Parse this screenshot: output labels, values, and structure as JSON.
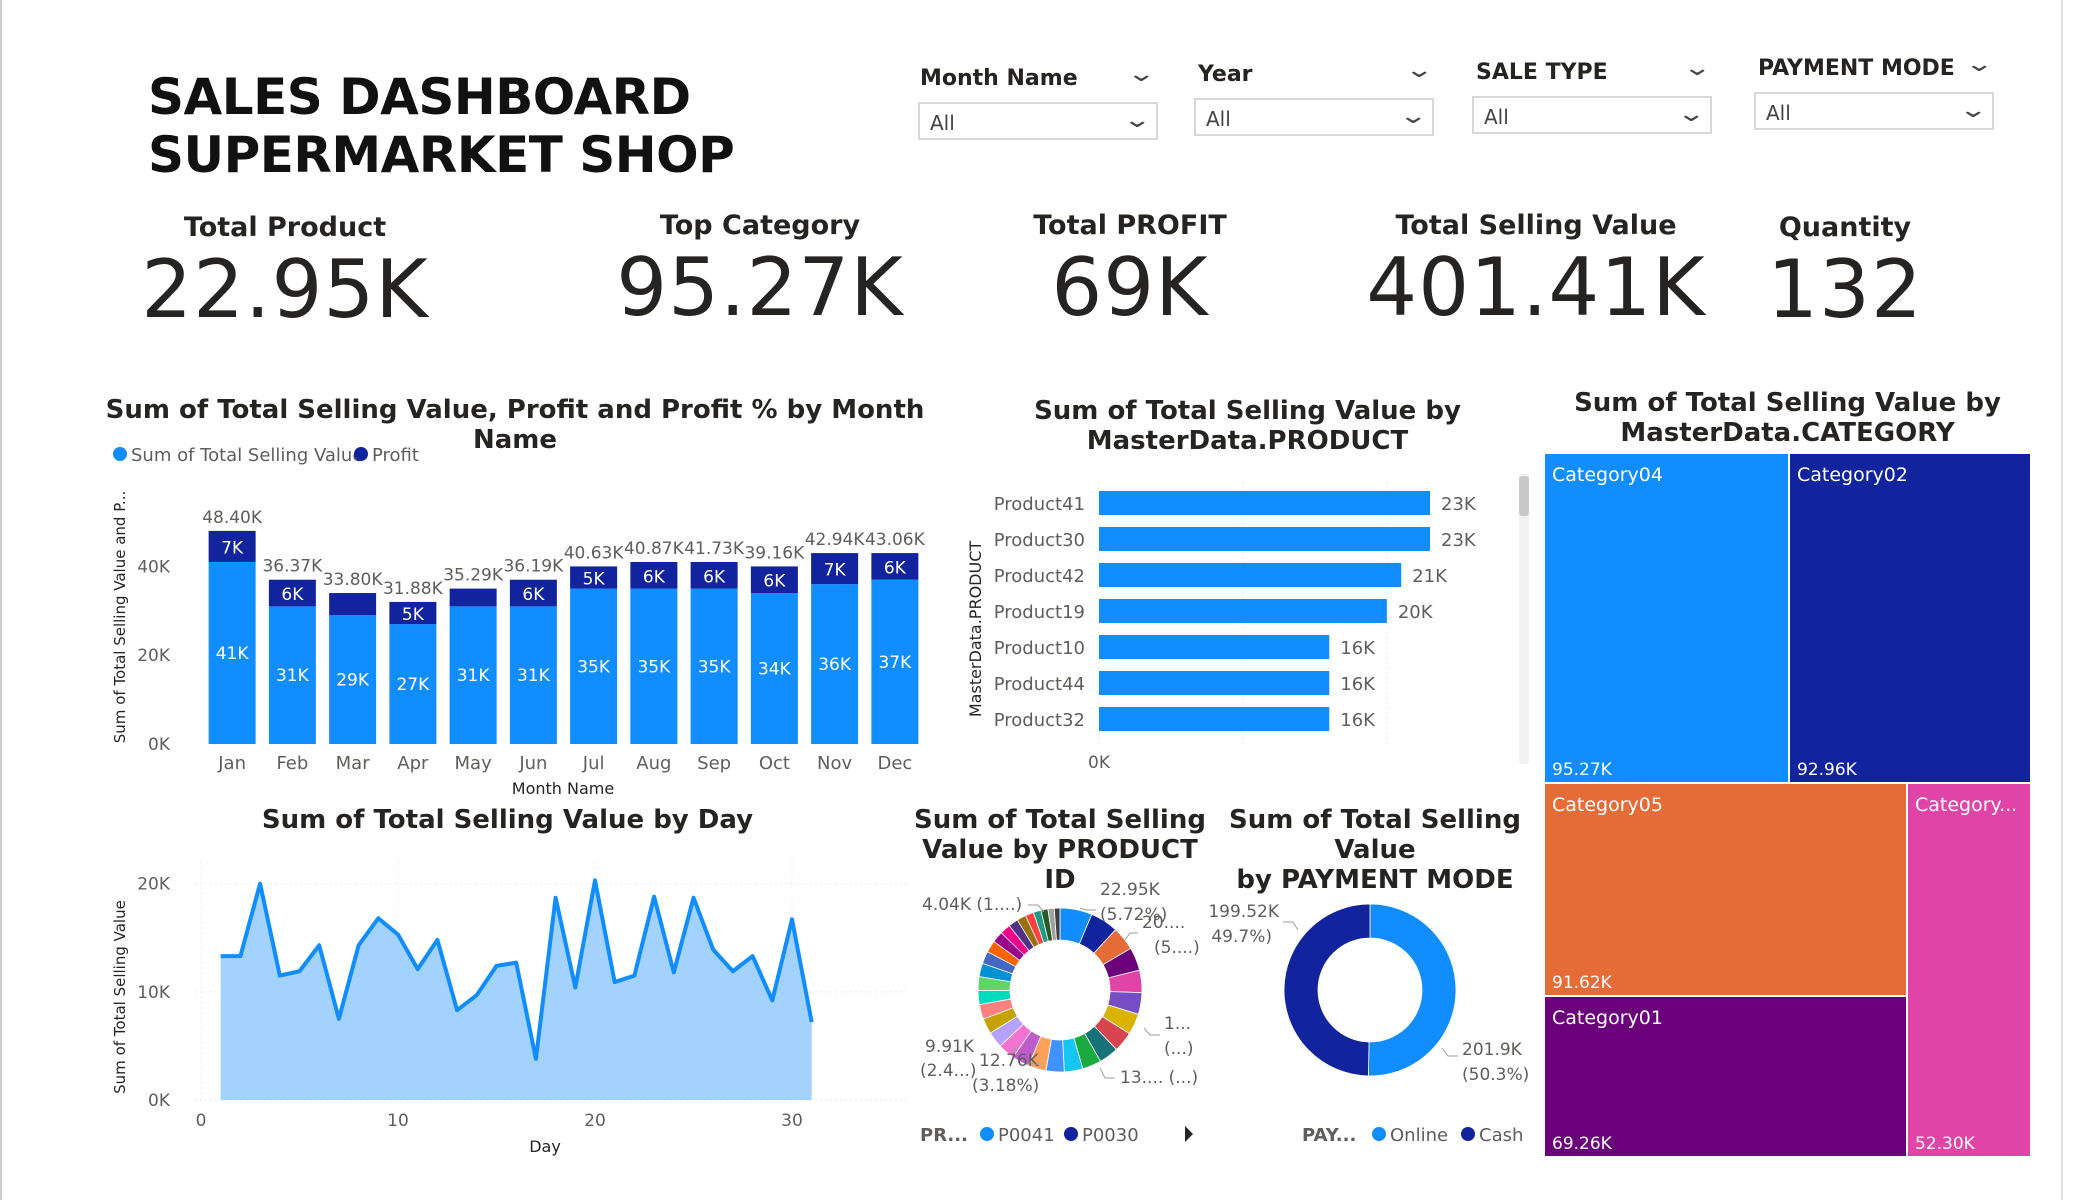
{
  "title": {
    "line1": "SALES DASHBOARD",
    "line2": "SUPERMARKET SHOP"
  },
  "slicers": [
    {
      "label": "Month Name",
      "value": "All"
    },
    {
      "label": "Year",
      "value": "All"
    },
    {
      "label": "SALE TYPE",
      "value": "All"
    },
    {
      "label": "PAYMENT MODE",
      "value": "All"
    }
  ],
  "kpis": [
    {
      "label": "Total Product",
      "value": "22.95K"
    },
    {
      "label": "Top Category",
      "value": "95.27K"
    },
    {
      "label": "Total PROFIT",
      "value": "69K"
    },
    {
      "label": "Total Selling Value",
      "value": "401.41K"
    },
    {
      "label": "Quantity",
      "value": "132"
    }
  ],
  "colors": {
    "selling": "#118DFF",
    "profit": "#12239E",
    "area_fill": "#A3D2FF",
    "cat04": "#118DFF",
    "cat02": "#12239E",
    "cat05": "#E66C37",
    "cat01": "#6B007B",
    "cat_other": "#E044A7"
  },
  "chart_data": [
    {
      "type": "bar",
      "stacked": true,
      "title": "Sum of Total Selling Value, Profit and Profit % by Month Name",
      "xlabel": "Month Name",
      "ylabel": "Sum of Total Selling Value and P...",
      "ylim": [
        0,
        50000
      ],
      "yticks": [
        "0K",
        "20K",
        "40K"
      ],
      "categories": [
        "Jan",
        "Feb",
        "Mar",
        "Apr",
        "May",
        "Jun",
        "Jul",
        "Aug",
        "Sep",
        "Oct",
        "Nov",
        "Dec"
      ],
      "series": [
        {
          "name": "Sum of Total Selling Value",
          "values": [
            41000,
            31000,
            29000,
            27000,
            31000,
            31000,
            35000,
            35000,
            35000,
            34000,
            36000,
            37000
          ],
          "labels": [
            "41K",
            "31K",
            "29K",
            "27K",
            "31K",
            "31K",
            "35K",
            "35K",
            "35K",
            "34K",
            "36K",
            "37K"
          ]
        },
        {
          "name": "Profit",
          "values": [
            7000,
            6000,
            5000,
            5000,
            4000,
            6000,
            5000,
            6000,
            6000,
            6000,
            7000,
            6000
          ],
          "labels": [
            "7K",
            "6K",
            "",
            "5K",
            "",
            "6K",
            "5K",
            "6K",
            "6K",
            "6K",
            "7K",
            "6K"
          ]
        }
      ],
      "totals": [
        "48.40K",
        "36.37K",
        "33.80K",
        "31.88K",
        "35.29K",
        "36.19K",
        "40.63K",
        "40.87K",
        "41.73K",
        "39.16K",
        "42.94K",
        "43.06K"
      ],
      "legend": "top-left"
    },
    {
      "type": "bar",
      "orientation": "horizontal",
      "title": "Sum of Total Selling Value by MasterData.PRODUCT",
      "title_lines": [
        "Sum of Total Selling Value by",
        "MasterData.PRODUCT"
      ],
      "ylabel": "MasterData.PRODUCT",
      "xtick": "0K",
      "categories": [
        "Product41",
        "Product30",
        "Product42",
        "Product19",
        "Product10",
        "Product44",
        "Product32"
      ],
      "values": [
        23000,
        23000,
        21000,
        20000,
        16000,
        16000,
        16000
      ],
      "labels": [
        "23K",
        "23K",
        "21K",
        "20K",
        "16K",
        "16K",
        "16K"
      ]
    },
    {
      "type": "treemap",
      "title": "Sum of Total Selling Value by MasterData.CATEGORY",
      "title_lines": [
        "Sum of Total Selling Value by",
        "MasterData.CATEGORY"
      ],
      "items": [
        {
          "name": "Category04",
          "value": 95270,
          "label": "95.27K"
        },
        {
          "name": "Category02",
          "value": 92960,
          "label": "92.96K"
        },
        {
          "name": "Category05",
          "value": 91620,
          "label": "91.62K"
        },
        {
          "name": "Category01",
          "value": 69260,
          "label": "69.26K"
        },
        {
          "name": "Category...",
          "value": 52300,
          "label": "52.30K"
        }
      ]
    },
    {
      "type": "area",
      "title": "Sum of Total Selling Value by Day",
      "xlabel": "Day",
      "ylabel": "Sum of Total Selling Value",
      "xlim": [
        0,
        31
      ],
      "ylim": [
        0,
        22000
      ],
      "xticks": [
        0,
        10,
        20,
        30
      ],
      "yticks": [
        "0K",
        "10K",
        "20K"
      ],
      "x": [
        1,
        2,
        3,
        4,
        5,
        6,
        7,
        8,
        9,
        10,
        11,
        12,
        13,
        14,
        15,
        16,
        17,
        18,
        19,
        20,
        21,
        22,
        23,
        24,
        25,
        26,
        27,
        28,
        29,
        30,
        31
      ],
      "y": [
        13300,
        13300,
        20000,
        11500,
        11900,
        14300,
        7500,
        14300,
        16800,
        15300,
        12100,
        14800,
        8300,
        9700,
        12400,
        12700,
        3800,
        18700,
        10400,
        20300,
        10900,
        11500,
        18800,
        11800,
        18700,
        13900,
        11900,
        13300,
        9200,
        16700,
        7200
      ]
    },
    {
      "type": "pie",
      "donut": true,
      "title": "Sum of Total Selling Value by PRODUCT ID",
      "title_lines": [
        "Sum of Total Selling",
        "Value by PRODUCT ID"
      ],
      "legend_title": "PR...",
      "legend": [
        "P0041",
        "P0030"
      ],
      "labels": [
        {
          "l1": "22.95K",
          "l2": "(5.72%)"
        },
        {
          "l1": "20....",
          "l2": "(5....)"
        },
        {
          "l1": "1...",
          "l2": "(...)"
        },
        {
          "l1": "13.... (...)",
          "l2": ""
        },
        {
          "l1": "12.76K",
          "l2": "(3.18%)"
        },
        {
          "l1": "9.91K",
          "l2": "(2.4...)"
        },
        {
          "l1": "4.04K (1....)",
          "l2": ""
        }
      ],
      "slices": [
        22950,
        20000,
        17000,
        16500,
        16000,
        15500,
        15000,
        14500,
        14000,
        13500,
        13200,
        13000,
        12760,
        12500,
        12000,
        11500,
        11000,
        10500,
        10000,
        9910,
        9500,
        9000,
        8500,
        8000,
        7500,
        7000,
        6500,
        6000,
        5500,
        5000,
        4500,
        4040
      ]
    },
    {
      "type": "pie",
      "donut": true,
      "title": "Sum of Total Selling Value by PAYMENT MODE",
      "title_lines": [
        "Sum of Total Selling Value",
        "by PAYMENT MODE"
      ],
      "legend_title": "PAY...",
      "categories": [
        "Online",
        "Cash"
      ],
      "values": [
        201900,
        199520
      ],
      "labels": [
        {
          "l1": "201.9K",
          "l2": "(50.3%)"
        },
        {
          "l1": "199.52K",
          "l2": "(49.7%)"
        }
      ]
    }
  ]
}
